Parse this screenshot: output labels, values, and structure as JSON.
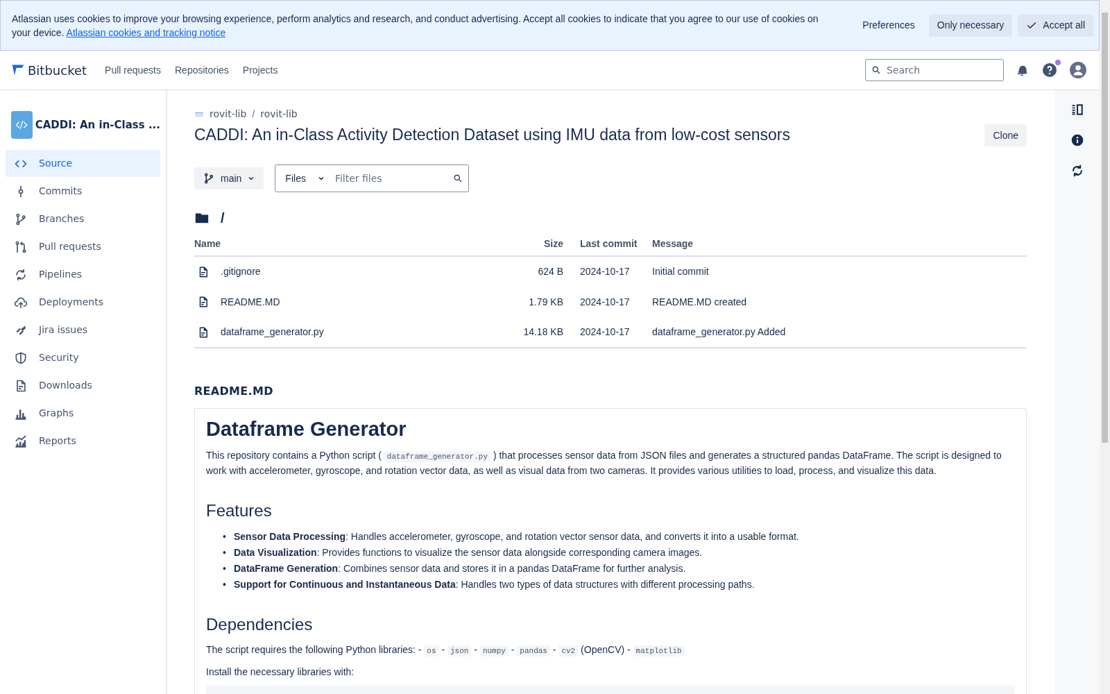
{
  "cookie_banner": {
    "text": "Atlassian uses cookies to improve your browsing experience, perform analytics and research, and conduct advertising. Accept all cookies to indicate that you agree to our use of cookies on your device.",
    "link": "Atlassian cookies and tracking notice",
    "buttons": [
      {
        "label": "Preferences",
        "kind": "subtle"
      },
      {
        "label": "Only necessary",
        "kind": "default"
      },
      {
        "label": "Accept all",
        "kind": "check"
      }
    ]
  },
  "header": {
    "product": "Bitbucket",
    "nav": [
      "Pull requests",
      "Repositories",
      "Projects"
    ],
    "search": {
      "placeholder": "Search"
    },
    "help_notification": true
  },
  "sidebar": {
    "repo_name": "CADDI: An in-Class ...",
    "items": [
      {
        "label": "Source",
        "selected": true
      },
      {
        "label": "Commits",
        "selected": false
      },
      {
        "label": "Branches",
        "selected": false
      },
      {
        "label": "Pull requests",
        "selected": false
      },
      {
        "label": "Pipelines",
        "selected": false
      },
      {
        "label": "Deployments",
        "selected": false
      },
      {
        "label": "Jira issues",
        "selected": false
      },
      {
        "label": "Security",
        "selected": false
      },
      {
        "label": "Downloads",
        "selected": false
      },
      {
        "label": "Graphs",
        "selected": false
      },
      {
        "label": "Reports",
        "selected": false
      }
    ]
  },
  "breadcrumbs": {
    "items": [
      "rovit-lib",
      "rovit-lib"
    ],
    "separator": "/"
  },
  "title": "CADDI: An in-Class Activity Detection Dataset using IMU data from low-cost sensors",
  "clone_button": "Clone",
  "branch": "main",
  "files_dropdown": "Files",
  "filter": {
    "placeholder": "Filter files"
  },
  "path": "/",
  "table": {
    "columns": [
      "Name",
      "Size",
      "Last commit",
      "Message"
    ],
    "rows": [
      {
        "name": ".gitignore",
        "size": "624 B",
        "last_commit": "2024-10-17",
        "message": "Initial commit"
      },
      {
        "name": "README.MD",
        "size": "1.79 KB",
        "last_commit": "2024-10-17",
        "message": "README.MD created"
      },
      {
        "name": "dataframe_generator.py",
        "size": "14.18 KB",
        "last_commit": "2024-10-17",
        "message": "dataframe_generator.py Added"
      }
    ]
  },
  "readme": {
    "filename": "README.MD",
    "blocks": [
      {
        "kind": "h1",
        "text": "Dataframe Generator"
      },
      {
        "kind": "p",
        "parts": [
          {
            "kind": "text",
            "text": "This repository contains a Python script ( "
          },
          {
            "kind": "code",
            "text": "dataframe_generator.py"
          },
          {
            "kind": "text",
            "text": " ) that processes sensor data from JSON files and generates a structured pandas DataFrame. The script is designed to work with accelerometer, gyroscope, and rotation vector data, as well as visual data from two cameras. It provides various utilities to load, process, and visualize this data."
          }
        ]
      },
      {
        "kind": "h2",
        "text": "Features"
      },
      {
        "kind": "ul",
        "items": [
          {
            "bullet": "•",
            "text": "**Sensor Data Processing**: Handles accelerometer, gyroscope, and rotation vector sensor data, and converts it into a usable format."
          },
          {
            "bullet": "•",
            "text": "**Data Visualization**: Provides functions to visualize the sensor data alongside corresponding camera images."
          },
          {
            "bullet": "•",
            "text": "**DataFrame Generation**: Combines sensor data and stores it in a pandas DataFrame for further analysis."
          },
          {
            "bullet": "•",
            "text": "**Support for Continuous and Instantaneous Data**: Handles two types of data structures with different processing paths."
          }
        ]
      },
      {
        "kind": "h2",
        "text": "Dependencies"
      },
      {
        "kind": "p",
        "parts": [
          {
            "kind": "text",
            "text": "The script requires the following Python libraries: - "
          },
          {
            "kind": "code",
            "text": "os"
          },
          {
            "kind": "text",
            "text": " - "
          },
          {
            "kind": "code",
            "text": "json"
          },
          {
            "kind": "text",
            "text": " - "
          },
          {
            "kind": "code",
            "text": "numpy"
          },
          {
            "kind": "text",
            "text": " - "
          },
          {
            "kind": "code",
            "text": "pandas"
          },
          {
            "kind": "text",
            "text": " - "
          },
          {
            "kind": "code",
            "text": "cv2"
          },
          {
            "kind": "text",
            "text": " (OpenCV) - "
          },
          {
            "kind": "code",
            "text": "matplotlib"
          }
        ]
      },
      {
        "kind": "p",
        "parts": [
          {
            "kind": "text",
            "text": "Install the necessary libraries with:"
          }
        ]
      },
      {
        "kind": "pre"
      }
    ]
  }
}
